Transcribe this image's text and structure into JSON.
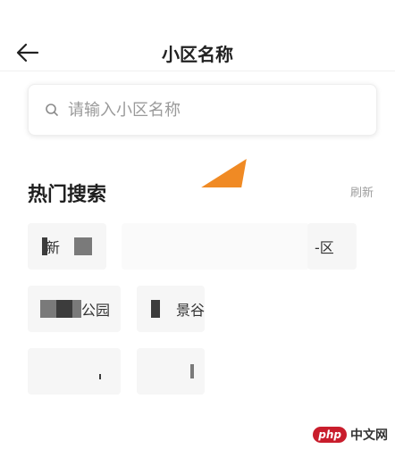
{
  "header": {
    "title": "小区名称",
    "back_icon": "arrow-left-icon"
  },
  "search": {
    "placeholder": "请输入小区名称",
    "value": "",
    "icon": "search-icon"
  },
  "hot_search": {
    "title": "热门搜索",
    "refresh_label": "刷新",
    "chips": [
      {
        "text": "新"
      },
      {
        "text": ""
      },
      {
        "text": "-区"
      },
      {
        "text": "公园"
      },
      {
        "text": "景谷"
      },
      {
        "text": ""
      },
      {
        "text": ""
      }
    ]
  },
  "watermark": {
    "logo": "php",
    "text": "中文网"
  },
  "colors": {
    "accent": "#f08a24",
    "chip_bg": "#f6f6f6",
    "muted": "#9e9e9e"
  }
}
